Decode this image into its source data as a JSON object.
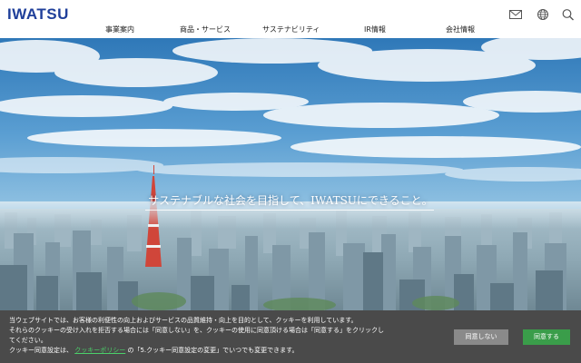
{
  "brand": {
    "logo_text": "IWATSU",
    "color": "#1f3f9a"
  },
  "nav": {
    "items": [
      {
        "label": "事業案内"
      },
      {
        "label": "商品・サービス"
      },
      {
        "label": "サステナビリティ"
      },
      {
        "label": "IR情報"
      },
      {
        "label": "会社情報"
      }
    ]
  },
  "header_icons": [
    "mail-icon",
    "globe-icon",
    "search-icon"
  ],
  "hero": {
    "tagline": "サステナブルな社会を目指して、IWATSUにできること。"
  },
  "cookie": {
    "line1": "当ウェブサイトでは、お客様の利便性の向上およびサービスの品質維持・向上を目的として、クッキーを利用しています。",
    "line2": "それらのクッキーの受け入れを拒否する場合には「同意しない」を、クッキーの使用に同意頂ける場合は「同意する」をクリックし",
    "line3": "てください。",
    "line4_prefix": "クッキー同意設定は、",
    "policy_link": "クッキーポリシー",
    "line4_suffix": "の「5.クッキー同意設定の変更」でいつでも変更できます。",
    "decline_label": "同意しない",
    "accept_label": "同意する",
    "accept_color": "#3a9d4a",
    "link_color": "#4bd06a"
  }
}
